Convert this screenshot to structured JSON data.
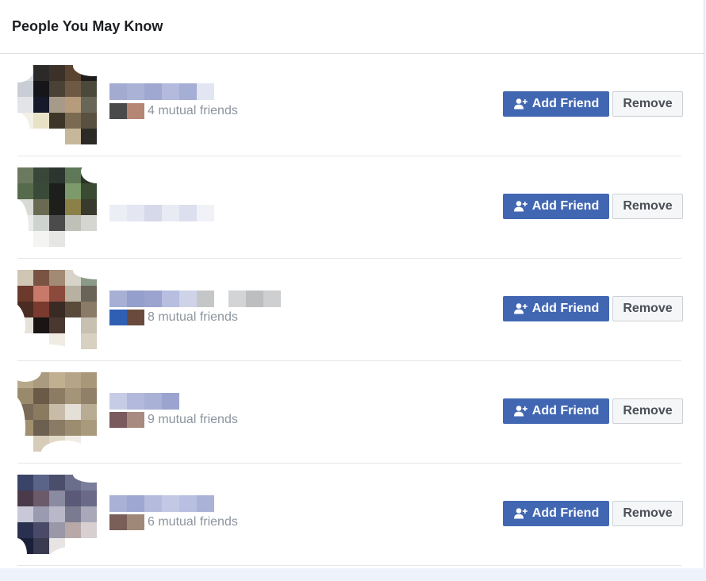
{
  "panel": {
    "title": "People You May Know"
  },
  "buttons": {
    "add_friend": "Add Friend",
    "remove": "Remove"
  },
  "suggestions": [
    {
      "mutual_text": "4 mutual friends",
      "name_colors": [
        "#a3acd0",
        "#aab2d6",
        "#9ea8d0",
        "#b3badd",
        "#a5aed4",
        "#e2e5f2"
      ],
      "thumb_colors": [
        "#4a4a4a",
        "#b58673"
      ],
      "avatar_colors": [
        "#d8dde6",
        "#2b2a28",
        "#3b3128",
        "#5a4330",
        "#1e1d1c",
        "#c9ced6",
        "#16161a",
        "#4a4237",
        "#6e5a44",
        "#4b4a3a",
        "#e2e4e8",
        "#15192b",
        "#a89a88",
        "#b69b7c",
        "#6a6657",
        "#f3f0e6",
        "#e8e1c6",
        "#3d3528",
        "#7b6a52",
        "#5a5040",
        "#ffffff",
        "#ffffff",
        "#ffffff",
        "#c6b79a",
        "#2c2a25"
      ]
    },
    {
      "mutual_text": "",
      "name_colors": [
        "#eceef5",
        "#e4e7f1",
        "#d5d9ea",
        "#e8ebf4",
        "#dbdfee",
        "#f0f2f8"
      ],
      "thumb_colors": [],
      "avatar_colors": [
        "#6b7a5e",
        "#39463a",
        "#2d3530",
        "#5e7858",
        "#2a3328",
        "#556b4b",
        "#3a4a38",
        "#1c1f1c",
        "#7d9a6a",
        "#3b4a33",
        "#d7dad5",
        "#6a6a52",
        "#1e1e1a",
        "#8a8048",
        "#3a3a2c",
        "#e9ebe9",
        "#cfd3cf",
        "#4a4b4a",
        "#bfc0b8",
        "#d5d6d2",
        "#ffffff",
        "#f4f4f2",
        "#e6e6e4",
        "#ffffff",
        "#ffffff"
      ]
    },
    {
      "mutual_text": "8 mutual friends",
      "name_colors": [
        "#a7b0d4",
        "#959fcb",
        "#9aa4ce",
        "#b7bedf",
        "#cfd3e8",
        "#c4c6c8",
        "#d3d4d6",
        "#bdbec0",
        "#cecfd1"
      ],
      "thumb_colors": [
        "#2f5fb4",
        "#6a4a3c"
      ],
      "avatar_colors": [
        "#cfc6b4",
        "#7a5442",
        "#a38a74",
        "#d8d3c8",
        "#8a9a88",
        "#6b3a2c",
        "#c87a6a",
        "#8b4a3c",
        "#b8b0a0",
        "#6a6458",
        "#4a2c22",
        "#7a3a2e",
        "#3a2a24",
        "#5a4a3a",
        "#8a7a68",
        "#e6e2da",
        "#1a1414",
        "#4a3830",
        "#ffffff",
        "#c8c0b0",
        "#ffffff",
        "#ffffff",
        "#f0ece4",
        "#ffffff",
        "#d8d0c0"
      ]
    },
    {
      "mutual_text": "9 mutual friends",
      "name_colors": [
        "#c7cce6",
        "#b2b9dc",
        "#a9b1d7",
        "#9aa4cf"
      ],
      "thumb_colors": [
        "#7a5a5c",
        "#a88a80"
      ],
      "avatar_colors": [
        "#b8a88a",
        "#a99a80",
        "#c0b090",
        "#b4a488",
        "#a89878",
        "#9a8a6c",
        "#6a5a48",
        "#8c7c64",
        "#a49478",
        "#908068",
        "#7a6a58",
        "#8a7a60",
        "#c8bca8",
        "#e4e0d8",
        "#b8ac94",
        "#a09070",
        "#6c6050",
        "#8a7c64",
        "#9c8c70",
        "#aa9a7c",
        "#ffffff",
        "#d6ccb8",
        "#e2dac8",
        "#f0ece4",
        "#ffffff"
      ]
    },
    {
      "mutual_text": "6 mutual friends",
      "name_colors": [
        "#a9b1d6",
        "#9ea7d1",
        "#b4bbdd",
        "#c3c8e4",
        "#b9bfe0",
        "#aab2d7"
      ],
      "thumb_colors": [
        "#7a5e58",
        "#a08878"
      ],
      "avatar_colors": [
        "#3a4468",
        "#5a6488",
        "#4a4e6a",
        "#6a6e8a",
        "#7a7e9a",
        "#4a3a4a",
        "#6a5a6a",
        "#8a8aa0",
        "#5a5a78",
        "#6a6a88",
        "#c8c8d8",
        "#9a9ab0",
        "#b8b8c8",
        "#7a7a90",
        "#a8a8b8",
        "#2a3050",
        "#4a4a68",
        "#9a98a8",
        "#b8a8a8",
        "#d8d0d0",
        "#1a2038",
        "#3a3a50",
        "#e8e4e4",
        "#ffffff",
        "#ffffff"
      ]
    }
  ]
}
